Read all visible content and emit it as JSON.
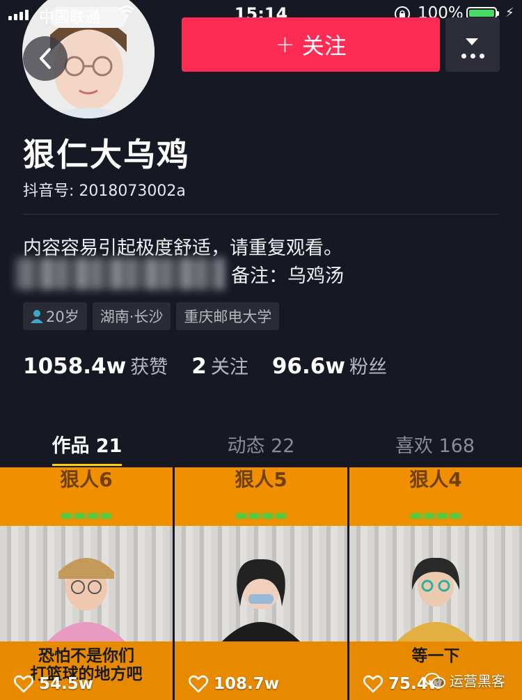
{
  "status_bar": {
    "carrier": "中国联通",
    "time": "15:14",
    "battery_percent": "100%",
    "battery_color": "#4cd964"
  },
  "header": {
    "follow_label": "关注",
    "follow_color": "#fe2c55",
    "back_icon": "chevron-left-icon",
    "more_icon": "more-dots-icon"
  },
  "profile": {
    "name": "狠仁大乌鸡",
    "douyin_id": "抖音号: 2018073002a",
    "bio": "内容容易引起极度舒适，请重复观看。",
    "note": "备注：乌鸡汤",
    "tags": {
      "age": "20岁",
      "location": "湖南·长沙",
      "school": "重庆邮电大学"
    },
    "stats": {
      "likes_num": "1058.4w",
      "likes_label": "获赞",
      "following_num": "2",
      "following_label": "关注",
      "fans_num": "96.6w",
      "fans_label": "粉丝"
    }
  },
  "tabs": {
    "works": "作品 21",
    "moments": "动态 22",
    "likes": "喜欢 168"
  },
  "videos": [
    {
      "title": "狠人6",
      "caption_line1": "恐怕不是你们",
      "caption_line2": "打篮球的地方吧",
      "likes": "54.5w"
    },
    {
      "title": "狠人5",
      "caption_line1": "",
      "caption_line2": "",
      "likes": "108.7w"
    },
    {
      "title": "狠人4",
      "caption_line1": "等一下",
      "caption_line2": "",
      "likes": "75.4w"
    }
  ],
  "watermark": "运营黑客"
}
